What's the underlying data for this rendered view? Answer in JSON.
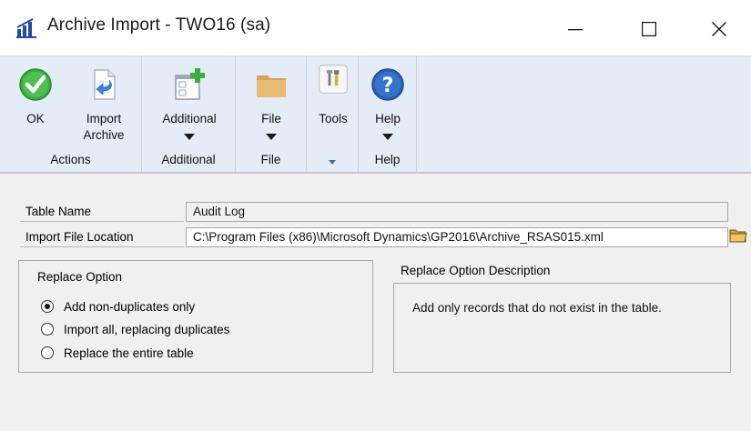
{
  "window": {
    "title": "Archive Import  -  TWO16 (sa)",
    "controls": {
      "minimize": "minimize",
      "maximize": "maximize",
      "close": "close"
    }
  },
  "ribbon": {
    "groups": [
      {
        "label": "Actions",
        "buttons": [
          {
            "label": "OK",
            "icon": "checkmark-icon"
          },
          {
            "label": "Import Archive",
            "label_line1": "Import",
            "label_line2": "Archive",
            "icon": "import-document-icon"
          }
        ]
      },
      {
        "label": "Additional",
        "buttons": [
          {
            "label": "Additional",
            "icon": "add-window-icon",
            "dropdown": true
          }
        ]
      },
      {
        "label": "File",
        "buttons": [
          {
            "label": "File",
            "icon": "folder-icon",
            "dropdown": true
          }
        ]
      },
      {
        "label": "",
        "buttons": [
          {
            "label": "Tools",
            "icon": "tools-icon"
          }
        ]
      },
      {
        "label": "Help",
        "buttons": [
          {
            "label": "Help",
            "icon": "help-icon",
            "dropdown": true
          }
        ]
      }
    ]
  },
  "form": {
    "table_name": {
      "label": "Table Name",
      "value": "Audit Log"
    },
    "import_file_location": {
      "label": "Import File Location",
      "value": "C:\\Program Files (x86)\\Microsoft Dynamics\\GP2016\\Archive_RSAS015.xml"
    },
    "replace_option": {
      "title": "Replace Option",
      "options": [
        {
          "label": "Add non-duplicates only",
          "checked": true
        },
        {
          "label": "Import all, replacing duplicates",
          "checked": false
        },
        {
          "label": "Replace the entire table",
          "checked": false
        }
      ]
    },
    "replace_description": {
      "title": "Replace Option Description",
      "text": "Add only records that do not exist in the table."
    }
  },
  "colors": {
    "ribbon_bg": "#e3ecf7",
    "content_bg": "#f0f0f0",
    "ok_green": "#3cae3f",
    "help_blue": "#2a64b8",
    "folder_tan": "#e2b469"
  }
}
